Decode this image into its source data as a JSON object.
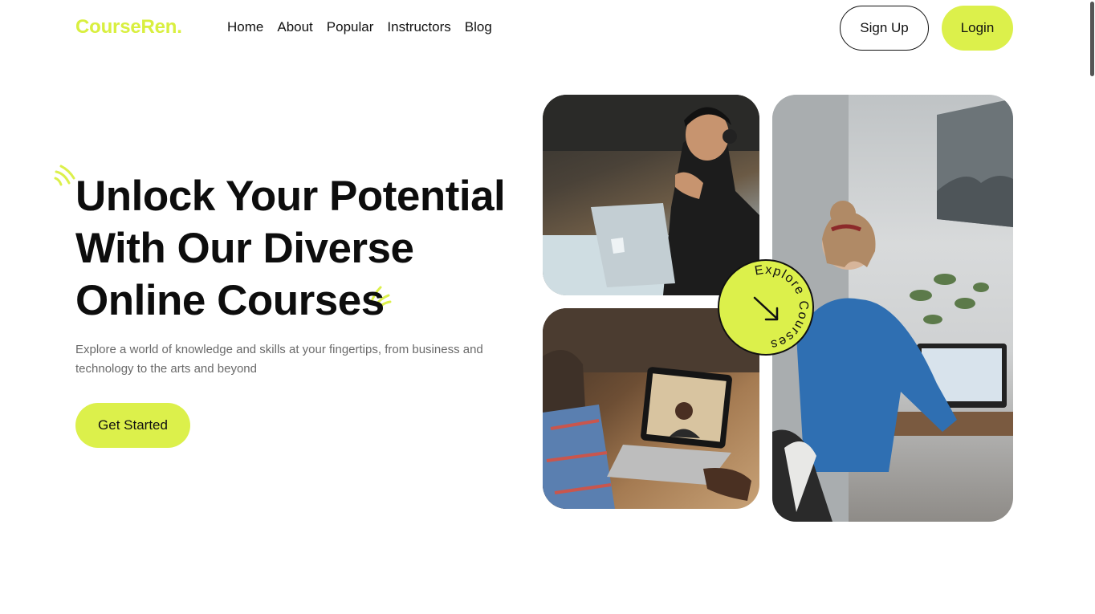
{
  "brand": {
    "logo": "CourseRen.",
    "accent": "#dcf04b"
  },
  "nav": {
    "items": [
      {
        "label": "Home"
      },
      {
        "label": "About"
      },
      {
        "label": "Popular"
      },
      {
        "label": "Instructors"
      },
      {
        "label": "Blog"
      }
    ]
  },
  "auth": {
    "signup_label": "Sign Up",
    "login_label": "Login"
  },
  "hero": {
    "title_line1": "Unlock Your Potential",
    "title_line2": "With Our Diverse",
    "title_line3": "Online Courses",
    "subtitle": "Explore a world of knowledge and skills at your fingertips, from business and technology to the arts and beyond",
    "cta_label": "Get Started"
  },
  "badge": {
    "text": "Explore Courses",
    "icon": "arrow-down-right-icon"
  },
  "images": [
    {
      "name": "student-with-headphones-photo"
    },
    {
      "name": "video-call-laptop-photo"
    },
    {
      "name": "woman-working-laptop-photo"
    }
  ]
}
